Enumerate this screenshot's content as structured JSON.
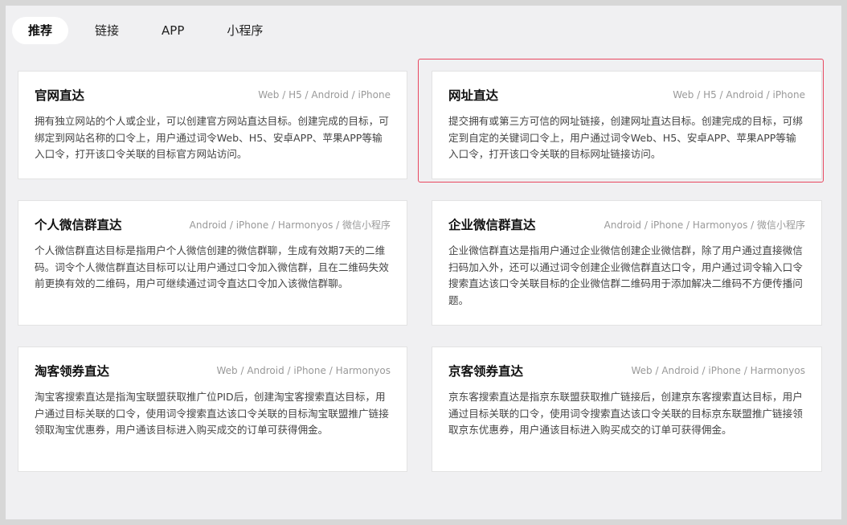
{
  "tabs": [
    {
      "label": "推荐",
      "active": true
    },
    {
      "label": "链接",
      "active": false
    },
    {
      "label": "APP",
      "active": false
    },
    {
      "label": "小程序",
      "active": false
    }
  ],
  "cards": [
    {
      "title": "官网直达",
      "platforms": "Web / H5 / Android / iPhone",
      "desc": "拥有独立网站的个人或企业，可以创建官方网站直达目标。创建完成的目标，可绑定到网站名称的口令上，用户通过词令Web、H5、安卓APP、苹果APP等输入口令，打开该口令关联的目标官方网站访问。"
    },
    {
      "title": "网址直达",
      "platforms": "Web / H5 / Android / iPhone",
      "desc": "提交拥有或第三方可信的网址链接，创建网址直达目标。创建完成的目标，可绑定到自定的关键词口令上，用户通过词令Web、H5、安卓APP、苹果APP等输入口令，打开该口令关联的目标网址链接访问。",
      "selected": true
    },
    {
      "title": "个人微信群直达",
      "platforms": "Android / iPhone / Harmonyos / 微信小程序",
      "desc": "个人微信群直达目标是指用户个人微信创建的微信群聊，生成有效期7天的二维码。词令个人微信群直达目标可以让用户通过口令加入微信群，且在二维码失效前更换有效的二维码，用户可继续通过词令直达口令加入该微信群聊。"
    },
    {
      "title": "企业微信群直达",
      "platforms": "Android / iPhone / Harmonyos / 微信小程序",
      "desc": "企业微信群直达是指用户通过企业微信创建企业微信群，除了用户通过直接微信扫码加入外，还可以通过词令创建企业微信群直达口令，用户通过词令输入口令搜索直达该口令关联目标的企业微信群二维码用于添加解决二维码不方便传播问题。"
    },
    {
      "title": "淘客领券直达",
      "platforms": "Web / Android / iPhone / Harmonyos",
      "desc": "淘宝客搜索直达是指淘宝联盟获取推广位PID后，创建淘宝客搜索直达目标，用户通过目标关联的口令，使用词令搜索直达该口令关联的目标淘宝联盟推广链接领取淘宝优惠券，用户通该目标进入购买成交的订单可获得佣金。"
    },
    {
      "title": "京客领券直达",
      "platforms": "Web / Android / iPhone / Harmonyos",
      "desc": "京东客搜索直达是指京东联盟获取推广链接后，创建京东客搜索直达目标，用户通过目标关联的口令，使用词令搜索直达该口令关联的目标京东联盟推广链接领取京东优惠券，用户通该目标进入购买成交的订单可获得佣金。"
    }
  ]
}
